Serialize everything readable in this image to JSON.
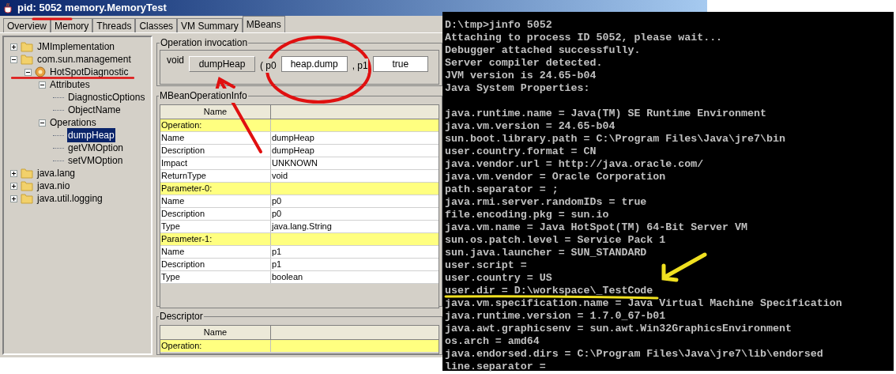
{
  "window": {
    "title": "pid: 5052 memory.MemoryTest"
  },
  "tabs": [
    {
      "label": "Overview",
      "selected": false
    },
    {
      "label": "Memory",
      "selected": false
    },
    {
      "label": "Threads",
      "selected": false
    },
    {
      "label": "Classes",
      "selected": false
    },
    {
      "label": "VM Summary",
      "selected": false
    },
    {
      "label": "MBeans",
      "selected": true
    }
  ],
  "tree": [
    {
      "label": "JMImplementation",
      "kind": "folder",
      "expanded": false,
      "selected": false
    },
    {
      "label": "com.sun.management",
      "kind": "folder",
      "expanded": true,
      "selected": false,
      "children": [
        {
          "label": "HotSpotDiagnostic",
          "kind": "bean",
          "expanded": true,
          "selected": false,
          "children": [
            {
              "label": "Attributes",
              "expanded": true,
              "selected": false,
              "children": [
                {
                  "label": "DiagnosticOptions",
                  "selected": false
                },
                {
                  "label": "ObjectName",
                  "selected": false
                }
              ]
            },
            {
              "label": "Operations",
              "expanded": true,
              "selected": false,
              "children": [
                {
                  "label": "dumpHeap",
                  "selected": true
                },
                {
                  "label": "getVMOption",
                  "selected": false
                },
                {
                  "label": "setVMOption",
                  "selected": false
                }
              ]
            }
          ]
        }
      ]
    },
    {
      "label": "java.lang",
      "kind": "folder",
      "expanded": false,
      "selected": false
    },
    {
      "label": "java.nio",
      "kind": "folder",
      "expanded": false,
      "selected": false
    },
    {
      "label": "java.util.logging",
      "kind": "folder",
      "expanded": false,
      "selected": false
    }
  ],
  "invocation": {
    "title": "Operation invocation",
    "return_type": "void",
    "button": "dumpHeap",
    "p0_label": "( p0",
    "p0_value": "heap.dump",
    "p1_label": ", p1",
    "p1_value": "true"
  },
  "operation_info": {
    "title": "MBeanOperationInfo",
    "columns": [
      "Name"
    ],
    "rows": [
      {
        "kind": "section",
        "name": "Operation:"
      },
      {
        "kind": "row",
        "name": "Name",
        "value": "dumpHeap"
      },
      {
        "kind": "row",
        "name": "Description",
        "value": "dumpHeap"
      },
      {
        "kind": "row",
        "name": "Impact",
        "value": "UNKNOWN"
      },
      {
        "kind": "row",
        "name": "ReturnType",
        "value": "void"
      },
      {
        "kind": "section",
        "name": "Parameter-0:"
      },
      {
        "kind": "row",
        "name": "Name",
        "value": "p0"
      },
      {
        "kind": "row",
        "name": "Description",
        "value": "p0"
      },
      {
        "kind": "row",
        "name": "Type",
        "value": "java.lang.String"
      },
      {
        "kind": "section",
        "name": "Parameter-1:"
      },
      {
        "kind": "row",
        "name": "Name",
        "value": "p1"
      },
      {
        "kind": "row",
        "name": "Description",
        "value": "p1"
      },
      {
        "kind": "row",
        "name": "Type",
        "value": "boolean"
      }
    ]
  },
  "descriptor": {
    "title": "Descriptor",
    "columns": [
      "Name"
    ],
    "rows": [
      {
        "kind": "section",
        "name": "Operation:"
      }
    ]
  },
  "console": {
    "header_lines": [
      "D:\\tmp>jinfo 5052",
      "Attaching to process ID 5052, please wait...",
      "Debugger attached successfully.",
      "Server compiler detected.",
      "JVM version is 24.65-b04",
      "Java System Properties:"
    ],
    "property_lines": [
      "java.runtime.name = Java(TM) SE Runtime Environment",
      "java.vm.version = 24.65-b04",
      "sun.boot.library.path = C:\\Program Files\\Java\\jre7\\bin",
      "user.country.format = CN",
      "java.vendor.url = http://java.oracle.com/",
      "java.vm.vendor = Oracle Corporation",
      "path.separator = ;",
      "java.rmi.server.randomIDs = true",
      "file.encoding.pkg = sun.io",
      "java.vm.name = Java HotSpot(TM) 64-Bit Server VM",
      "sun.os.patch.level = Service Pack 1",
      "sun.java.launcher = SUN_STANDARD",
      "user.script =",
      "user.country = US",
      "user.dir = D:\\workspace\\_TestCode",
      "java.vm.specification.name = Java Virtual Machine Specification",
      "java.runtime.version = 1.7.0_67-b01",
      "java.awt.graphicsenv = sun.awt.Win32GraphicsEnvironment",
      "os.arch = amd64",
      "java.endorsed.dirs = C:\\Program Files\\Java\\jre7\\lib\\endorsed",
      "line.separator ="
    ]
  }
}
